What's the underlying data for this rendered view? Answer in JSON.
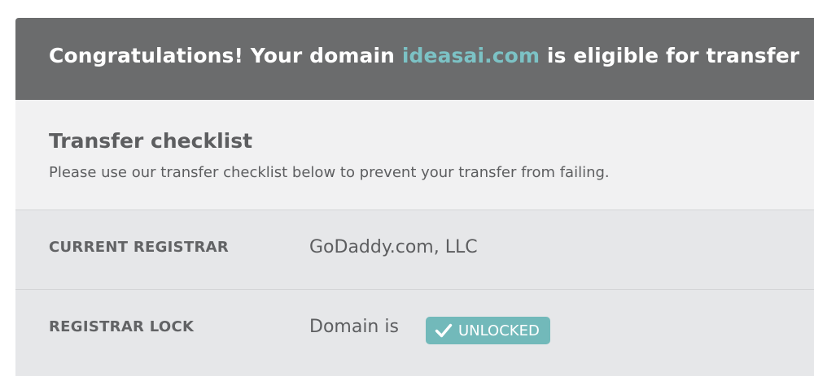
{
  "banner": {
    "prefix": "Congratulations! Your domain ",
    "domain": "ideasai.com",
    "suffix": " is eligible for transfer"
  },
  "checklist": {
    "title": "Transfer checklist",
    "description": "Please use our transfer checklist below to prevent your transfer from failing."
  },
  "rows": [
    {
      "label": "CURRENT REGISTRAR",
      "value": "GoDaddy.com, LLC"
    },
    {
      "label": "REGISTRAR LOCK",
      "value": "Domain is",
      "badge": {
        "icon": "checkmark-icon",
        "text": "UNLOCKED",
        "color": "#72b9ba"
      }
    }
  ],
  "colors": {
    "banner_bg": "#6b6c6d",
    "domain_accent": "#7cc2c5",
    "checklist_bg": "#f1f1f2",
    "rows_bg": "#e6e7e9"
  }
}
